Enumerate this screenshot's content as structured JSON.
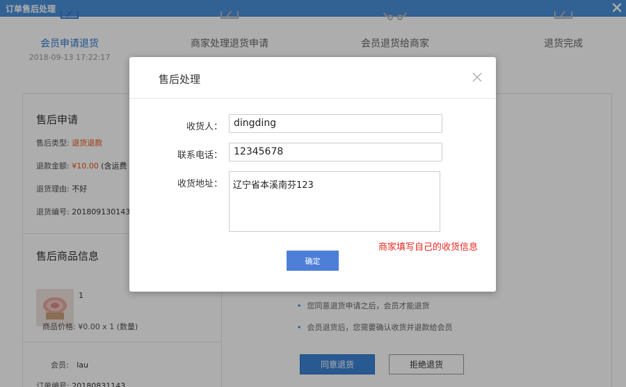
{
  "window": {
    "title": "订单售后处理"
  },
  "steps": [
    {
      "label": "会员申请退货",
      "date": "2018-09-13 17:22:17"
    },
    {
      "label": "商家处理退货申请"
    },
    {
      "label": "会员退货给商家"
    },
    {
      "label": "退货完成"
    }
  ],
  "apply": {
    "title": "售后申请",
    "type_label": "售后类型:",
    "type_value": "退货退款",
    "amount_label": "退款金额:",
    "amount_value": "¥10.00",
    "amount_note": "(含运费",
    "reason_label": "退货理由:",
    "reason_value": "不好",
    "number_label": "退货编号:",
    "number_value": "201809130143-"
  },
  "goods": {
    "title": "售后商品信息",
    "quantity_tag": "1",
    "price_text": "商品价格: ¥0.00 x 1 (数量)",
    "member_label": "会员:",
    "member_value": "lau",
    "order_label": "订单编号:",
    "order_value": "20180831143"
  },
  "tips": [
    "您同意退货申请之后，会员才能退货",
    "会员退货后，您需要确认收货并退款给会员"
  ],
  "actions": {
    "agree": "同意退货",
    "refuse": "拒绝退货"
  },
  "modal": {
    "title": "售后处理",
    "receiver_label": "收货人：",
    "receiver_value": "dingding",
    "phone_label": "联系电话：",
    "phone_value": "12345678",
    "address_label": "收货地址：",
    "address_value": "辽宁省本溪南芬123",
    "hint": "商家填写自己的收货信息",
    "confirm": "确定"
  },
  "colors": {
    "titlebar": "#4a90d9",
    "accent": "#2b7bd3",
    "orange": "#e8540f",
    "hint_red": "#e8261f",
    "confirm": "#4d7fd8"
  }
}
